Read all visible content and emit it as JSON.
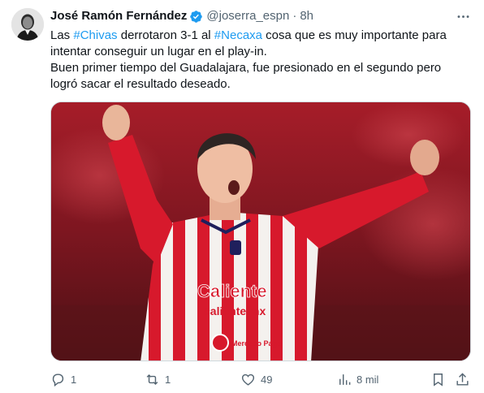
{
  "tweet": {
    "author_name": "José Ramón Fernández",
    "handle": "@joserra_espn",
    "separator": "·",
    "time": "8h",
    "line1": {
      "pre": "Las ",
      "tag1": "#Chivas",
      "mid": " derrotaron 3-1 al ",
      "tag2": "#Necaxa",
      "post": " cosa que es muy importante para"
    },
    "line2": "intentar conseguir un lugar en el play-in.",
    "line3": "Buen primer tiempo del Guadalajara, fue presionado en el segundo pero",
    "line4": "logró sacar el resultado deseado.",
    "media": {
      "jersey_sponsor_1": "Caliente",
      "jersey_sponsor_2": "caliente.mx",
      "jersey_badge_text": "Mercado Pago"
    },
    "actions": {
      "replies": "1",
      "reposts": "1",
      "likes": "49",
      "views": "8 mil"
    }
  },
  "icons": {
    "verified": "verified-badge-icon",
    "more": "more-horizontal-icon",
    "reply": "reply-icon",
    "repost": "repost-icon",
    "like": "heart-icon",
    "views": "views-chart-icon",
    "bookmark": "bookmark-icon",
    "share": "share-icon"
  },
  "colors": {
    "text": "#0f1419",
    "muted": "#536471",
    "link": "#1d9bf0",
    "verified": "#1d9bf0",
    "jersey_red": "#d7192c"
  }
}
